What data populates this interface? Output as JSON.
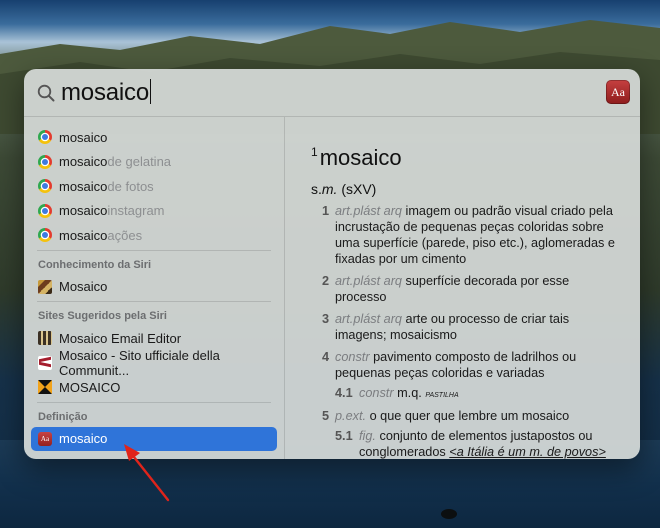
{
  "search": {
    "query": "mosaico"
  },
  "results": {
    "suggestions": [
      {
        "prefix": "mosaico",
        "rest": ""
      },
      {
        "prefix": "mosaico",
        "rest": " de gelatina"
      },
      {
        "prefix": "mosaico",
        "rest": " de fotos"
      },
      {
        "prefix": "mosaico",
        "rest": " instagram"
      },
      {
        "prefix": "mosaico",
        "rest": " ações"
      }
    ],
    "siri_knowledge": {
      "heading": "Conhecimento da Siri",
      "items": [
        {
          "label": "Mosaico"
        }
      ]
    },
    "siri_sites": {
      "heading": "Sites Sugeridos pela Siri",
      "items": [
        {
          "label": "Mosaico Email Editor"
        },
        {
          "label": "Mosaico - Sito ufficiale della Communit..."
        },
        {
          "label": "MOSAICO"
        }
      ]
    },
    "definition_section": {
      "heading": "Definição",
      "items": [
        {
          "label": "mosaico"
        }
      ]
    }
  },
  "definition": {
    "headword_index": "1",
    "headword": "mosaico",
    "pos": "s.m.",
    "etym": "(sXV)",
    "senses": [
      {
        "num": "1",
        "labels": "art.plást arq",
        "text": "imagem ou padrão visual criado pela incrustação de pequenas peças coloridas sobre uma superfície (parede, piso etc.), aglomeradas e fixadas por um cimento"
      },
      {
        "num": "2",
        "labels": "art.plást arq",
        "text": "superfície decorada por esse processo"
      },
      {
        "num": "3",
        "labels": "art.plást arq",
        "text": "arte ou processo de criar tais imagens; mosaicismo"
      },
      {
        "num": "4",
        "labels": "constr",
        "text": "pavimento composto de ladrilhos ou pequenas peças coloridas e variadas"
      }
    ],
    "sense_4_1": {
      "num": "4.1",
      "labels": "constr",
      "text": "m.q.",
      "sc": "pastilha"
    },
    "sense_5": {
      "num": "5",
      "labels": "p.ext.",
      "text": "o que quer que lembre um mosaico"
    },
    "sense_5_1": {
      "num": "5.1",
      "labels": "fig.",
      "text": "conjunto de elementos justapostos ou conglomerados",
      "example": "<a Itália é um m. de povos>"
    }
  },
  "icons": {
    "search": "magnifier-icon",
    "dictionary_app": "dictionary-app-icon",
    "dictionary_app_glyph": "Aa",
    "colors": {
      "selection": "#2f74d9",
      "arrow": "#e0241b"
    }
  }
}
